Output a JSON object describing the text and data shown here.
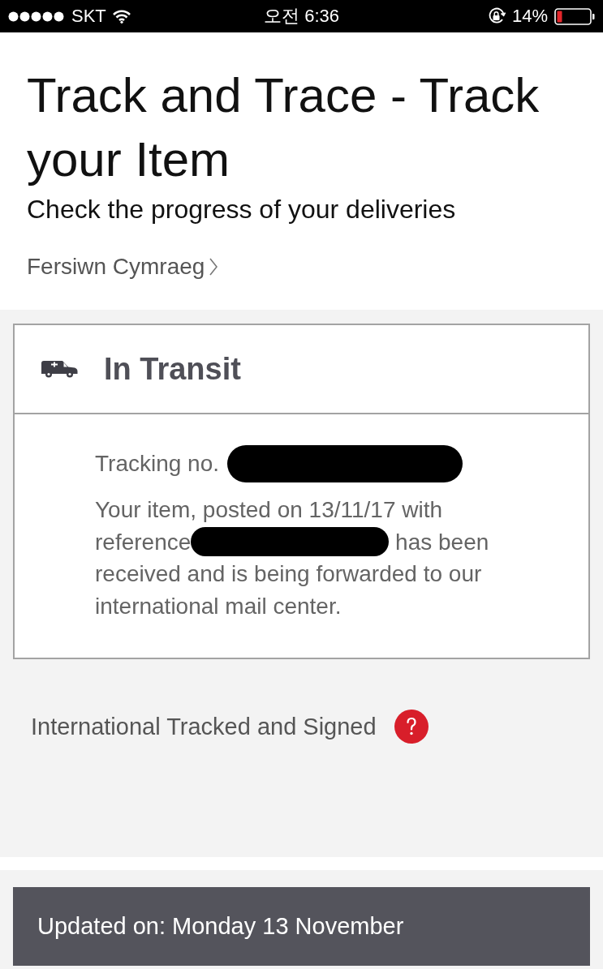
{
  "status_bar": {
    "carrier": "SKT",
    "time": "오전 6:36",
    "battery": "14%"
  },
  "header": {
    "title": "Track and Trace - Track your Item",
    "subtitle": "Check the progress of your deliveries",
    "language_link": "Fersiwn Cymraeg"
  },
  "status_card": {
    "status": "In Transit",
    "tracking_label": "Tracking no.",
    "tracking_redacted": true,
    "message_before": "Your item, posted on 13/11/17 with reference",
    "message_redacted": true,
    "message_after": "has been received and is being forwarded to our international mail center."
  },
  "service": {
    "name": "International Tracked and Signed"
  },
  "updated": {
    "text": "Updated on: Monday 13 November"
  }
}
